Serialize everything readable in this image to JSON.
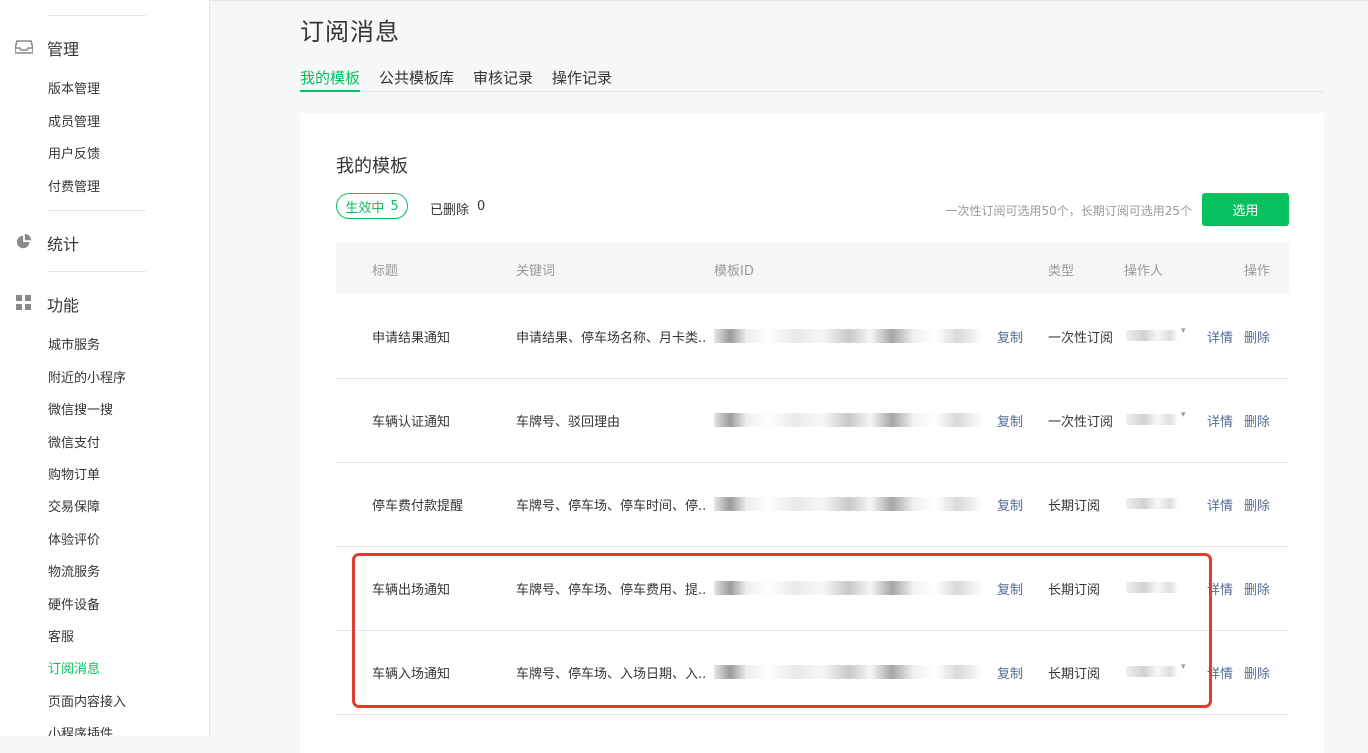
{
  "sidebar": {
    "sections": [
      {
        "title": "管理",
        "icon": "inbox-icon",
        "items": [
          "版本管理",
          "成员管理",
          "用户反馈",
          "付费管理"
        ]
      },
      {
        "title": "统计",
        "icon": "pie-chart-icon",
        "items": []
      },
      {
        "title": "功能",
        "icon": "grid-icon",
        "items": [
          "城市服务",
          "附近的小程序",
          "微信搜一搜",
          "微信支付",
          "购物订单",
          "交易保障",
          "体验评价",
          "物流服务",
          "硬件设备",
          "客服",
          "订阅消息",
          "页面内容接入",
          "小程序插件"
        ]
      }
    ],
    "active_item": "订阅消息"
  },
  "header": {
    "title": "订阅消息",
    "tabs": [
      "我的模板",
      "公共模板库",
      "审核记录",
      "操作记录"
    ],
    "active_tab": "我的模板"
  },
  "card": {
    "title": "我的模板",
    "active_badge_label": "生效中",
    "active_count": "5",
    "deleted_label": "已删除",
    "deleted_count": "0",
    "quota_note": "一次性订阅可选用50个，长期订阅可选用25个",
    "select_button": "选用"
  },
  "table": {
    "columns": [
      "标题",
      "关键词",
      "模板ID",
      "类型",
      "操作人",
      "操作"
    ],
    "copy_label": "复制",
    "detail_label": "详情",
    "delete_label": "删除",
    "rows": [
      {
        "title": "申请结果通知",
        "keywords": "申请结果、停车场名称、月卡类...",
        "type": "一次性订阅"
      },
      {
        "title": "车辆认证通知",
        "keywords": "车牌号、驳回理由",
        "type": "一次性订阅"
      },
      {
        "title": "停车费付款提醒",
        "keywords": "车牌号、停车场、停车时间、停...",
        "type": "长期订阅"
      },
      {
        "title": "车辆出场通知",
        "keywords": "车牌号、停车场、停车费用、提...",
        "type": "长期订阅"
      },
      {
        "title": "车辆入场通知",
        "keywords": "车牌号、停车场、入场日期、入...",
        "type": "长期订阅"
      }
    ]
  },
  "colors": {
    "accent": "#07c160",
    "link": "#576b95",
    "highlight": "#e13c2e"
  }
}
